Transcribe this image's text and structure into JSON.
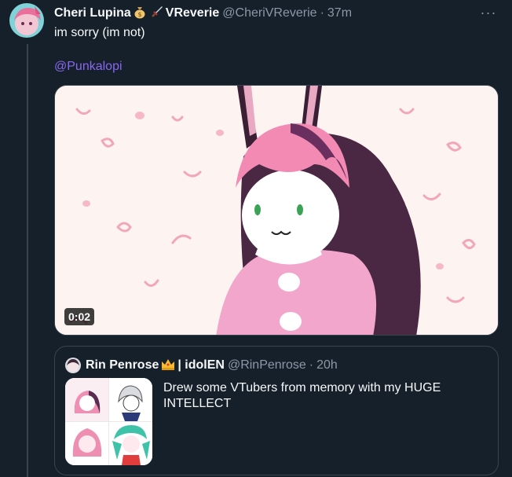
{
  "tweet": {
    "display_name": "Cheri Lupina",
    "name_suffix": "VReverie",
    "emojis": [
      "money-bag-emoji",
      "dagger-emoji"
    ],
    "handle": "@CheriVReverie",
    "separator": "·",
    "time": "37m",
    "more_label": "···",
    "text": "im sorry (im not)",
    "mention": "@Punkalopi",
    "media": {
      "type": "video",
      "duration": "0:02"
    }
  },
  "quote": {
    "display_name": "Rin Penrose",
    "name_suffix": "| idolEN",
    "emoji": "crown-emoji",
    "handle": "@RinPenrose",
    "separator": "·",
    "time": "20h",
    "text": "Drew some VTubers from memory with my HUGE INTELLECT"
  },
  "colors": {
    "background": "#15202b",
    "border": "#38444d",
    "secondary_text": "#8b98a5",
    "link": "#8a67f0"
  }
}
